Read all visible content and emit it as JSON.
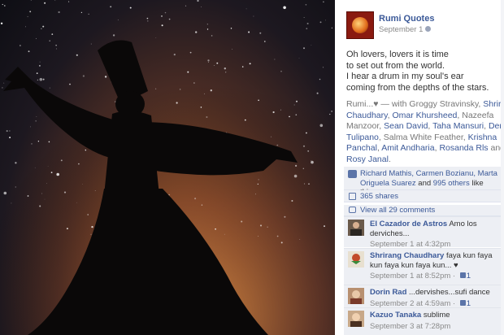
{
  "post": {
    "page_name": "Rumi Quotes",
    "date": "September 1",
    "quote_lines": [
      "Oh lovers, lovers it is time",
      "to set out from the world.",
      "I hear a drum in my soul's ear",
      "coming from the depths of the stars."
    ],
    "tag_prefix": "Rumi...♥ — with ",
    "tagged": [
      {
        "name": "Groggy Stravinsky",
        "linked": false
      },
      {
        "name": "Shrirang Chaudhary",
        "linked": true
      },
      {
        "name": "Omar Khursheed",
        "linked": true
      },
      {
        "name": "Nazeefa Manzoor",
        "linked": false
      },
      {
        "name": "Sean David",
        "linked": true
      },
      {
        "name": "Taha Mansuri",
        "linked": true
      },
      {
        "name": "Denise Tulipano",
        "linked": true
      },
      {
        "name": "Salma White Feather",
        "linked": false
      },
      {
        "name": "Krishna Panchal",
        "linked": true
      },
      {
        "name": "Amit Andharia",
        "linked": true
      },
      {
        "name": "Rosanda Rls",
        "linked": true
      },
      {
        "name": "Rosy Janal",
        "linked": true
      }
    ],
    "tag_and": "and",
    "tag_end": "."
  },
  "likes": {
    "names": "Richard Mathis, Carmen Bozianu, Marta Origuela Suarez",
    "and": " and ",
    "others": "995 others",
    "suffix": " like this."
  },
  "shares": "365 shares",
  "view_all": "View all 29 comments",
  "comments": [
    {
      "author": "El Cazador de Astros",
      "text": "Amo los derviches...",
      "time": "September 1 at 4:32pm",
      "likes": ""
    },
    {
      "author": "Shrirang Chaudhary",
      "text": "faya kun faya kun faya kun faya kun... ♥",
      "time": "September 1 at 8:52pm",
      "likes": "1"
    },
    {
      "author": "Dorin Rad",
      "text": "...dervishes...sufi dance",
      "time": "September 2 at 4:59am",
      "likes": "1"
    },
    {
      "author": "Kazuo Tanaka",
      "text": "sublime",
      "time": "September 3 at 7:28pm",
      "likes": ""
    }
  ],
  "colors": {
    "link": "#3b5998",
    "ufi_bg": "#edeff4",
    "meta": "#8a8a8a"
  }
}
